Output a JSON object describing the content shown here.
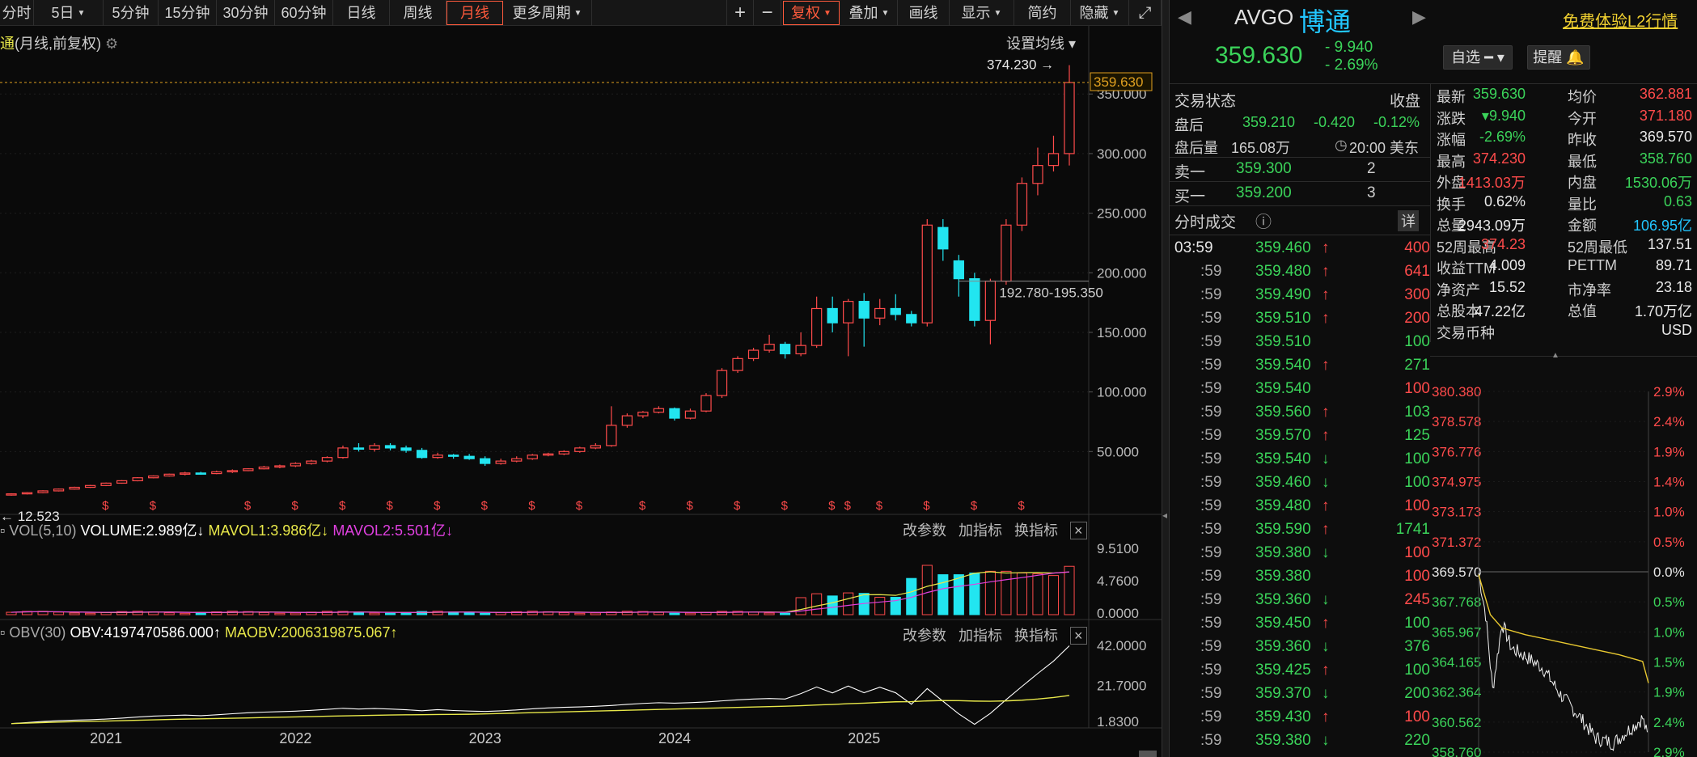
{
  "toolbar": {
    "items": [
      "分时",
      "5日",
      "5分钟",
      "15分钟",
      "30分钟",
      "60分钟",
      "日线",
      "周线",
      "月线",
      "更多周期"
    ],
    "active": "月线",
    "right_items": [
      "+",
      "−",
      "复权",
      "叠加",
      "画线",
      "显示",
      "简约",
      "隐藏"
    ]
  },
  "chart_title": {
    "name": "通",
    "params": "(月线,前复权)",
    "settings": "设置均线"
  },
  "colors": {
    "up": "#ff4b4b",
    "down": "#22e5f0",
    "bg": "#0a0a0a",
    "ma1": "#e8e84a",
    "ma2": "#e040e0",
    "obv": "#ffffff",
    "maobv": "#e8e84a",
    "price_line": "#e0a020",
    "grid": "#2a2a2a"
  },
  "chart_data": [
    {
      "type": "candlestick",
      "title": "博通 (月线,前复权)",
      "y_axis_ticks": [
        "350.000",
        "300.000",
        "250.000",
        "200.000",
        "150.000",
        "100.000",
        "50.000"
      ],
      "ylim": [
        0,
        380
      ],
      "x_axis_labels": [
        "2021",
        "2022",
        "2023",
        "2024",
        "2025"
      ],
      "current_price_label": "359.630",
      "high_label": "374.230",
      "low_label": "12.523",
      "range_label": "192.780-195.350",
      "candles": [
        [
          14,
          14.5,
          13,
          15
        ],
        [
          14.5,
          15.5,
          14,
          16
        ],
        [
          15.5,
          17,
          15,
          17.5
        ],
        [
          17,
          18.5,
          16.5,
          19
        ],
        [
          18.5,
          20,
          18,
          20.5
        ],
        [
          20,
          21.5,
          19.5,
          22
        ],
        [
          21.5,
          23.5,
          21,
          24
        ],
        [
          23.5,
          25.5,
          23,
          26
        ],
        [
          25.5,
          28,
          25,
          28.5
        ],
        [
          28,
          29.5,
          27.5,
          30
        ],
        [
          29.5,
          31,
          29,
          31.5
        ],
        [
          31,
          32,
          30,
          33
        ],
        [
          32,
          31.5,
          30.5,
          33
        ],
        [
          31.5,
          33,
          31,
          34
        ],
        [
          33,
          34,
          32,
          35
        ],
        [
          34,
          35.5,
          33.5,
          36
        ],
        [
          35.5,
          37,
          35,
          38
        ],
        [
          37,
          38,
          36,
          39
        ],
        [
          38,
          40,
          37,
          41
        ],
        [
          40,
          42,
          39,
          43
        ],
        [
          42,
          45,
          41,
          46
        ],
        [
          45,
          53,
          44,
          55
        ],
        [
          53,
          52,
          50,
          57
        ],
        [
          52,
          55,
          50,
          57
        ],
        [
          55,
          53,
          51,
          57
        ],
        [
          53,
          51,
          49,
          55
        ],
        [
          51,
          45,
          44,
          53
        ],
        [
          45,
          47,
          44,
          49
        ],
        [
          47,
          46,
          44,
          48
        ],
        [
          46,
          44,
          43,
          48
        ],
        [
          44,
          40,
          38,
          46
        ],
        [
          40,
          42,
          39,
          44
        ],
        [
          42,
          44,
          41,
          46
        ],
        [
          44,
          47,
          43,
          48
        ],
        [
          47,
          48,
          46,
          49
        ],
        [
          48,
          50,
          47,
          51
        ],
        [
          50,
          53,
          49,
          54
        ],
        [
          53,
          55,
          52,
          57
        ],
        [
          55,
          72,
          54,
          88
        ],
        [
          72,
          80,
          70,
          82
        ],
        [
          80,
          83,
          78,
          84
        ],
        [
          83,
          86,
          82,
          88
        ],
        [
          86,
          78,
          76,
          87
        ],
        [
          78,
          84,
          77,
          86
        ],
        [
          84,
          97,
          83,
          99
        ],
        [
          97,
          118,
          95,
          120
        ],
        [
          118,
          128,
          116,
          130
        ],
        [
          128,
          135,
          126,
          137
        ],
        [
          135,
          140,
          133,
          148
        ],
        [
          140,
          132,
          128,
          142
        ],
        [
          132,
          139,
          130,
          150
        ],
        [
          139,
          170,
          137,
          180
        ],
        [
          170,
          158,
          150,
          180
        ],
        [
          158,
          176,
          130,
          178
        ],
        [
          176,
          162,
          138,
          183
        ],
        [
          162,
          170,
          156,
          178
        ],
        [
          170,
          165,
          160,
          182
        ],
        [
          165,
          158,
          155,
          168
        ],
        [
          158,
          240,
          155,
          245
        ],
        [
          238,
          220,
          210,
          245
        ],
        [
          210,
          195,
          180,
          215
        ],
        [
          195,
          160,
          155,
          200
        ],
        [
          160,
          193,
          140,
          195
        ],
        [
          193,
          240,
          190,
          245
        ],
        [
          240,
          275,
          235,
          280
        ],
        [
          275,
          290,
          265,
          305
        ],
        [
          290,
          300,
          285,
          315
        ],
        [
          300,
          359.6,
          290,
          374.2
        ]
      ]
    },
    {
      "type": "bar",
      "title": "VOL(5,10)",
      "series_labels": {
        "volume": "VOLUME:2.989亿",
        "mavol1": "MAVOL1:3.986亿",
        "mavol2": "MAVOL2:5.501亿"
      },
      "y_axis_ticks": [
        "9.5100",
        "4.7600",
        "0.0000"
      ],
      "ylim": [
        0,
        9.51
      ]
    },
    {
      "type": "line",
      "title": "OBV(30)",
      "series_labels": {
        "obv": "OBV:4197470586.000",
        "maobv": "MAOBV:2006319875.067"
      },
      "y_axis_ticks": [
        "42.0000",
        "21.7000",
        "1.8300"
      ],
      "ylim": [
        1.83,
        42
      ]
    },
    {
      "type": "line",
      "title": "分时",
      "y_axis_left": [
        "380.380",
        "378.578",
        "376.776",
        "374.975",
        "373.173",
        "371.372",
        "369.570",
        "367.768",
        "365.967",
        "364.165",
        "362.364",
        "360.562",
        "358.760"
      ],
      "y_axis_right": [
        "2.9%",
        "2.4%",
        "1.9%",
        "1.4%",
        "1.0%",
        "0.5%",
        "0.0%",
        "0.5%",
        "1.0%",
        "1.5%",
        "1.9%",
        "2.4%",
        "2.9%"
      ]
    }
  ],
  "panel_controls": {
    "params": "改参数",
    "add": "加指标",
    "switch": "换指标",
    "close": "×"
  },
  "bottom_tabs": [
    "2021",
    "2022",
    "2023",
    "2024",
    "2025"
  ],
  "quote": {
    "code": "AVGO",
    "name": "博通",
    "free_l2": "免费体验L2行情",
    "price": "359.630",
    "change": "- 9.940",
    "change_pct": "- 2.69%",
    "watch_btn": "自选",
    "alert_btn": "提醒"
  },
  "trade_status": {
    "label": "交易状态",
    "status": "收盘",
    "after_label": "盘后",
    "after_price": "359.210",
    "after_chg": "-0.420",
    "after_pct": "-0.12%",
    "after_vol_label": "盘后量",
    "after_vol": "165.08万",
    "after_time": "20:00 美东",
    "ask_label": "卖一",
    "ask_price": "359.300",
    "ask_vol": "2",
    "bid_label": "买一",
    "bid_price": "359.200",
    "bid_vol": "3"
  },
  "stats": [
    [
      "最新",
      "359.630",
      "g",
      "均价",
      "362.881",
      "r"
    ],
    [
      "涨跌",
      "▾9.940",
      "g",
      "今开",
      "371.180",
      "r"
    ],
    [
      "涨幅",
      "-2.69%",
      "g",
      "昨收",
      "369.570",
      "w"
    ],
    [
      "最高",
      "374.230",
      "r",
      "最低",
      "358.760",
      "g"
    ],
    [
      "外盘",
      "1413.03万",
      "r",
      "内盘",
      "1530.06万",
      "g"
    ],
    [
      "换手",
      "0.62%",
      "w",
      "量比",
      "0.63",
      "g"
    ],
    [
      "总量",
      "2943.09万",
      "w",
      "金额",
      "106.95亿",
      "cy"
    ],
    [
      "52周最高",
      "374.23",
      "r",
      "52周最低",
      "137.51",
      "w"
    ],
    [
      "收益TTM",
      "4.009",
      "w",
      "PETTM",
      "89.71",
      "w"
    ],
    [
      "净资产",
      "15.52",
      "w",
      "市净率",
      "23.18",
      "w"
    ],
    [
      "总股本",
      "47.22亿",
      "w",
      "总值",
      "1.70万亿",
      "w"
    ],
    [
      "交易币种",
      "",
      "w",
      "",
      "USD",
      "w"
    ]
  ],
  "ticks": {
    "title": "分时成交",
    "detail": "详",
    "rows": [
      [
        "03:59",
        "359.460",
        "↑",
        "400",
        "r"
      ],
      [
        ":59",
        "359.480",
        "↑",
        "641",
        "r"
      ],
      [
        ":59",
        "359.490",
        "↑",
        "300",
        "r"
      ],
      [
        ":59",
        "359.510",
        "↑",
        "200",
        "r"
      ],
      [
        ":59",
        "359.510",
        "",
        "100",
        "g"
      ],
      [
        ":59",
        "359.540",
        "↑",
        "271",
        "g"
      ],
      [
        ":59",
        "359.540",
        "",
        "100",
        "r"
      ],
      [
        ":59",
        "359.560",
        "↑",
        "103",
        "g"
      ],
      [
        ":59",
        "359.570",
        "↑",
        "125",
        "g"
      ],
      [
        ":59",
        "359.540",
        "↓",
        "100",
        "g"
      ],
      [
        ":59",
        "359.460",
        "↓",
        "100",
        "g"
      ],
      [
        ":59",
        "359.480",
        "↑",
        "100",
        "r"
      ],
      [
        ":59",
        "359.590",
        "↑",
        "1741",
        "g"
      ],
      [
        ":59",
        "359.380",
        "↓",
        "100",
        "r"
      ],
      [
        ":59",
        "359.380",
        "",
        "100",
        "r"
      ],
      [
        ":59",
        "359.360",
        "↓",
        "245",
        "r"
      ],
      [
        ":59",
        "359.450",
        "↑",
        "100",
        "g"
      ],
      [
        ":59",
        "359.360",
        "↓",
        "376",
        "g"
      ],
      [
        ":59",
        "359.425",
        "↑",
        "100",
        "g"
      ],
      [
        ":59",
        "359.370",
        "↓",
        "200",
        "g"
      ],
      [
        ":59",
        "359.430",
        "↑",
        "100",
        "r"
      ],
      [
        ":59",
        "359.380",
        "↓",
        "220",
        "g"
      ]
    ]
  }
}
